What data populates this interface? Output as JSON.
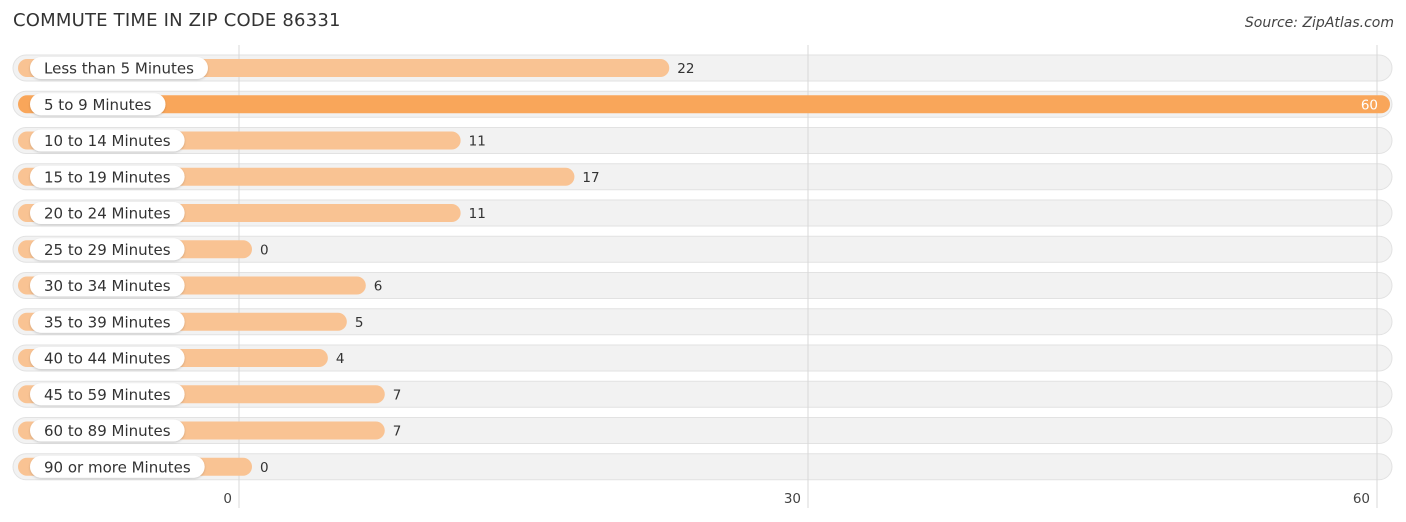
{
  "header": {
    "title": "COMMUTE TIME IN ZIP CODE 86331",
    "source": "Source: ZipAtlas.com"
  },
  "colors": {
    "bar": "#F9C393",
    "bar_highlight": "#F9A65A",
    "track": "#F2F2F2",
    "grid": "#D8D8D8"
  },
  "chart_data": {
    "type": "bar",
    "orientation": "horizontal",
    "title": "COMMUTE TIME IN ZIP CODE 86331",
    "xlabel": "",
    "ylabel": "",
    "categories": [
      "Less than 5 Minutes",
      "5 to 9 Minutes",
      "10 to 14 Minutes",
      "15 to 19 Minutes",
      "20 to 24 Minutes",
      "25 to 29 Minutes",
      "30 to 34 Minutes",
      "35 to 39 Minutes",
      "40 to 44 Minutes",
      "45 to 59 Minutes",
      "60 to 89 Minutes",
      "90 or more Minutes"
    ],
    "values": [
      22,
      60,
      11,
      17,
      11,
      0,
      6,
      5,
      4,
      7,
      7,
      0
    ],
    "highlight_index": 1,
    "xlim": [
      0,
      60
    ],
    "xticks": [
      0,
      30,
      60
    ],
    "xtick_labels": [
      "0",
      "30",
      "60"
    ],
    "grid": true
  }
}
